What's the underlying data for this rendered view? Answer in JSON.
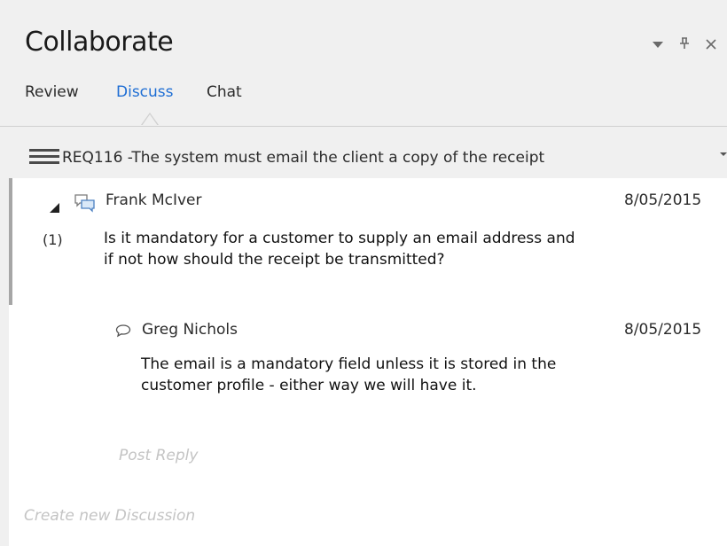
{
  "window": {
    "title": "Collaborate",
    "controls": {
      "dropdown": "▼",
      "pin": "ᵖ",
      "close": "×"
    }
  },
  "tabs": [
    {
      "label": "Review",
      "active": false
    },
    {
      "label": "Discuss",
      "active": true
    },
    {
      "label": "Chat",
      "active": false
    }
  ],
  "element": {
    "label": "REQ116 -The system must email the client a copy of the receipt"
  },
  "discussion": {
    "author": "Frank McIver",
    "date": "8/05/2015",
    "count": "(1)",
    "message_line1": "Is it mandatory for a customer to supply an email address and",
    "message_line2": "if not how should the receipt be transmitted?",
    "reply": {
      "author": "Greg Nichols",
      "date": "8/05/2015",
      "message_line1": "The email is a  mandatory field unless it is stored in the",
      "message_line2": "customer  profile - either way we will have it."
    }
  },
  "actions": {
    "post_reply": "Post Reply",
    "create_new": "Create new Discussion"
  },
  "colors": {
    "background": "#f0f0f0",
    "content_background": "#ffffff",
    "active_tab": "#1e6ed4",
    "placeholder_text": "#c4c4c4",
    "discussion_icon": "#4a7fc1"
  },
  "icons": {
    "discussion": "speech-bubbles-icon",
    "reply": "speech-bubble-outline-icon",
    "expand": "collapse-triangle-icon",
    "menu": "hamburger-menu-icon"
  }
}
